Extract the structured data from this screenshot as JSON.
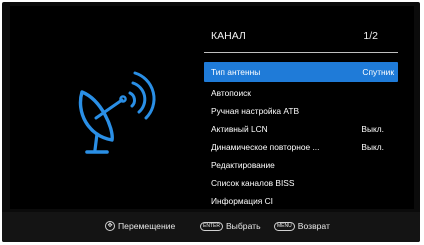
{
  "header": {
    "title": "КАНАЛ",
    "page": "1/2"
  },
  "menu": {
    "items": [
      {
        "label": "Тип антенны",
        "value": "Спутник"
      },
      {
        "label": "Автопоиск",
        "value": ""
      },
      {
        "label": "Ручная настройка АТВ",
        "value": ""
      },
      {
        "label": "Активный LCN",
        "value": "Выкл."
      },
      {
        "label": "Динамическое повторное ...",
        "value": "Выкл."
      },
      {
        "label": "Редактирование",
        "value": ""
      },
      {
        "label": "Список каналов BISS",
        "value": ""
      },
      {
        "label": "Информация CI",
        "value": ""
      }
    ],
    "selected_index": 0
  },
  "footer": {
    "move_label": "Перемещение",
    "enter_key": "ENTER",
    "select_label": "Выбрать",
    "menu_key": "MENU",
    "back_label": "Возврат"
  },
  "icons": {
    "main": "satellite-dish-icon"
  },
  "colors": {
    "accent": "#1f7bd8",
    "icon": "#2a8fe6",
    "background": "#000000"
  }
}
